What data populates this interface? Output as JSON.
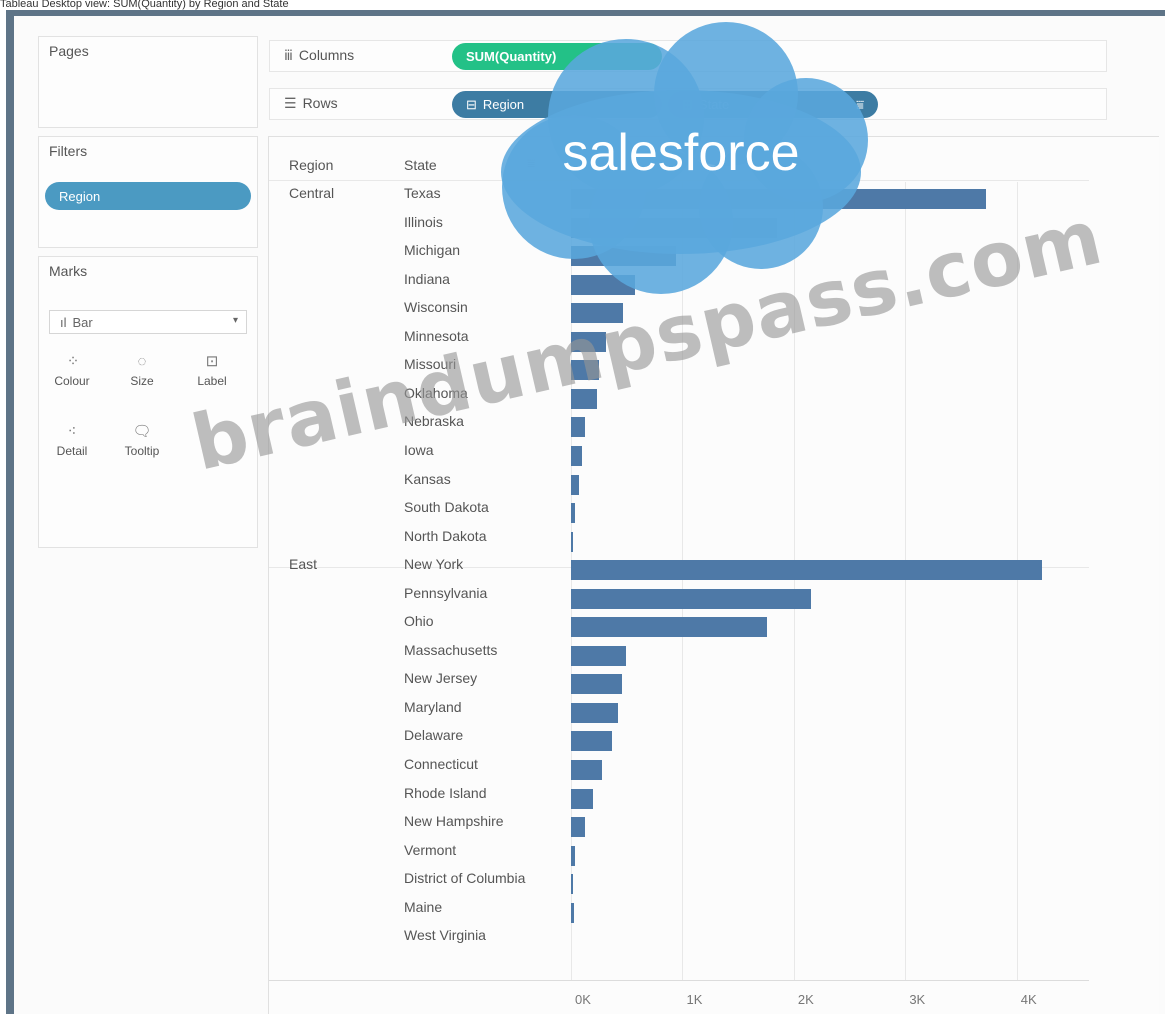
{
  "caption": "Tableau Desktop view: SUM(Quantity) by Region and State",
  "shelves": {
    "pages_title": "Pages",
    "filters_title": "Filters",
    "filter_pill": "Region",
    "marks_title": "Marks",
    "mark_type": "Bar",
    "mark_buttons": [
      "Colour",
      "Size",
      "Label",
      "Detail",
      "Tooltip"
    ],
    "columns_label": "Columns",
    "rows_label": "Rows",
    "columns_pill": "SUM(Quantity)",
    "rows_pills": [
      "Region",
      "State"
    ]
  },
  "view": {
    "region_header": "Region",
    "state_header": "State"
  },
  "overlay": {
    "logo_text": "salesforce",
    "watermark_text": "braindumpspass.com"
  },
  "colors": {
    "bar": "#4e79a7",
    "pill_blue": "#4b9ac2",
    "pill_green": "#23c187",
    "frame": "#5e7487",
    "logo_cloud": "#5aa7dd"
  },
  "chart_data": {
    "type": "bar",
    "orientation": "horizontal",
    "measure": "SUM(Quantity)",
    "xlim": [
      0,
      4200
    ],
    "tick_labels": [
      "0K",
      "1K",
      "2K",
      "3K",
      "4K"
    ],
    "tick_values": [
      0,
      1000,
      2000,
      3000,
      4000
    ],
    "groups": [
      {
        "region": "Central",
        "states": [
          "Texas",
          "Illinois",
          "Michigan",
          "Indiana",
          "Wisconsin",
          "Minnesota",
          "Missouri",
          "Oklahoma",
          "Nebraska",
          "Iowa",
          "Kansas",
          "South Dakota",
          "North Dakota"
        ],
        "values": [
          3724,
          1845,
          946,
          578,
          463,
          315,
          250,
          229,
          126,
          96,
          74,
          37,
          20
        ]
      },
      {
        "region": "East",
        "states": [
          "New York",
          "Pennsylvania",
          "Ohio",
          "Massachusetts",
          "New Jersey",
          "Maryland",
          "Delaware",
          "Connecticut",
          "Rhode Island",
          "New Hampshire",
          "Vermont",
          "District of Columbia",
          "Maine",
          "West Virginia"
        ],
        "values": [
          4224,
          2153,
          1759,
          491,
          454,
          420,
          367,
          281,
          199,
          124,
          36,
          20,
          25,
          0
        ]
      }
    ]
  }
}
